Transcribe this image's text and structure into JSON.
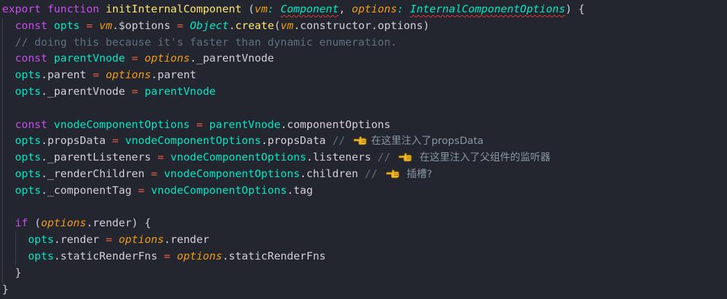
{
  "editor": {
    "language": "javascript",
    "colors": {
      "background": "#23262e",
      "keyword": "#c74ded",
      "function": "#ffe66d",
      "parameter": "#f39c12",
      "type": "#00e8c6",
      "operator": "#ee5d43",
      "comment": "#5f6f7e",
      "text": "#d5ced9"
    },
    "lines": [
      [
        {
          "t": "export",
          "c": "kw"
        },
        {
          "t": " ",
          "c": "punc"
        },
        {
          "t": "function",
          "c": "kw"
        },
        {
          "t": " ",
          "c": "punc"
        },
        {
          "t": "initInternalComponent",
          "c": "fn"
        },
        {
          "t": " (",
          "c": "punc"
        },
        {
          "t": "vm",
          "c": "param"
        },
        {
          "t": ": ",
          "c": "type"
        },
        {
          "t": "Component",
          "c": "type wavy"
        },
        {
          "t": ", ",
          "c": "punc"
        },
        {
          "t": "options",
          "c": "param"
        },
        {
          "t": ": ",
          "c": "type"
        },
        {
          "t": "InternalComponentOptions",
          "c": "type wavy"
        },
        {
          "t": ") {",
          "c": "punc"
        }
      ],
      [
        {
          "t": "  ",
          "c": "punc"
        },
        {
          "t": "const",
          "c": "kw"
        },
        {
          "t": " opts ",
          "c": "prop"
        },
        {
          "t": "=",
          "c": "op"
        },
        {
          "t": " ",
          "c": "punc"
        },
        {
          "t": "vm",
          "c": "param"
        },
        {
          "t": ".$options ",
          "c": "var"
        },
        {
          "t": "=",
          "c": "op"
        },
        {
          "t": " ",
          "c": "punc"
        },
        {
          "t": "Object",
          "c": "type"
        },
        {
          "t": ".",
          "c": "punc"
        },
        {
          "t": "create",
          "c": "fn"
        },
        {
          "t": "(",
          "c": "punc"
        },
        {
          "t": "vm",
          "c": "param"
        },
        {
          "t": ".constructor.options)",
          "c": "var"
        }
      ],
      [
        {
          "t": "  // doing this because it's faster than dynamic enumeration.",
          "c": "cm"
        }
      ],
      [
        {
          "t": "  ",
          "c": "punc"
        },
        {
          "t": "const",
          "c": "kw"
        },
        {
          "t": " parentVnode ",
          "c": "prop"
        },
        {
          "t": "=",
          "c": "op"
        },
        {
          "t": " ",
          "c": "punc"
        },
        {
          "t": "options",
          "c": "param"
        },
        {
          "t": "._parentVnode",
          "c": "var"
        }
      ],
      [
        {
          "t": "  ",
          "c": "punc"
        },
        {
          "t": "opts",
          "c": "prop"
        },
        {
          "t": ".parent ",
          "c": "var"
        },
        {
          "t": "=",
          "c": "op"
        },
        {
          "t": " ",
          "c": "punc"
        },
        {
          "t": "options",
          "c": "param"
        },
        {
          "t": ".parent",
          "c": "var"
        }
      ],
      [
        {
          "t": "  ",
          "c": "punc"
        },
        {
          "t": "opts",
          "c": "prop"
        },
        {
          "t": "._parentVnode ",
          "c": "var"
        },
        {
          "t": "=",
          "c": "op"
        },
        {
          "t": " parentVnode",
          "c": "prop"
        }
      ],
      [
        {
          "t": "",
          "c": "punc"
        }
      ],
      [
        {
          "t": "  ",
          "c": "punc"
        },
        {
          "t": "const",
          "c": "kw"
        },
        {
          "t": " vnodeComponentOptions ",
          "c": "prop"
        },
        {
          "t": "=",
          "c": "op"
        },
        {
          "t": " parentVnode",
          "c": "prop"
        },
        {
          "t": ".componentOptions",
          "c": "var"
        }
      ],
      [
        {
          "t": "  ",
          "c": "punc"
        },
        {
          "t": "opts",
          "c": "prop"
        },
        {
          "t": ".propsData ",
          "c": "var"
        },
        {
          "t": "=",
          "c": "op"
        },
        {
          "t": " vnodeComponentOptions",
          "c": "prop"
        },
        {
          "t": ".propsData ",
          "c": "var"
        },
        {
          "t": "// ",
          "c": "cm"
        },
        {
          "t": "",
          "c": "hand"
        },
        {
          "t": "在这里注入了propsData",
          "c": "cmt"
        }
      ],
      [
        {
          "t": "  ",
          "c": "punc"
        },
        {
          "t": "opts",
          "c": "prop"
        },
        {
          "t": "._parentListeners ",
          "c": "var"
        },
        {
          "t": "=",
          "c": "op"
        },
        {
          "t": " vnodeComponentOptions",
          "c": "prop"
        },
        {
          "t": ".listeners ",
          "c": "var"
        },
        {
          "t": "// ",
          "c": "cm"
        },
        {
          "t": "",
          "c": "hand"
        },
        {
          "t": " 在这里注入了父组件的监听器",
          "c": "cmt"
        }
      ],
      [
        {
          "t": "  ",
          "c": "punc"
        },
        {
          "t": "opts",
          "c": "prop"
        },
        {
          "t": "._renderChildren ",
          "c": "var"
        },
        {
          "t": "=",
          "c": "op"
        },
        {
          "t": " vnodeComponentOptions",
          "c": "prop"
        },
        {
          "t": ".children ",
          "c": "var"
        },
        {
          "t": "// ",
          "c": "cm"
        },
        {
          "t": "",
          "c": "hand"
        },
        {
          "t": " 插槽?",
          "c": "cmt"
        }
      ],
      [
        {
          "t": "  ",
          "c": "punc"
        },
        {
          "t": "opts",
          "c": "prop"
        },
        {
          "t": "._componentTag ",
          "c": "var"
        },
        {
          "t": "=",
          "c": "op"
        },
        {
          "t": " vnodeComponentOptions",
          "c": "prop"
        },
        {
          "t": ".tag",
          "c": "var"
        }
      ],
      [
        {
          "t": "",
          "c": "punc"
        }
      ],
      [
        {
          "t": "  ",
          "c": "punc"
        },
        {
          "t": "if",
          "c": "kw"
        },
        {
          "t": " (",
          "c": "punc"
        },
        {
          "t": "options",
          "c": "param"
        },
        {
          "t": ".render) {",
          "c": "var"
        }
      ],
      [
        {
          "t": "    ",
          "c": "punc"
        },
        {
          "t": "opts",
          "c": "prop"
        },
        {
          "t": ".render ",
          "c": "var"
        },
        {
          "t": "=",
          "c": "op"
        },
        {
          "t": " ",
          "c": "punc"
        },
        {
          "t": "options",
          "c": "param"
        },
        {
          "t": ".render",
          "c": "var"
        }
      ],
      [
        {
          "t": "    ",
          "c": "punc"
        },
        {
          "t": "opts",
          "c": "prop"
        },
        {
          "t": ".staticRenderFns ",
          "c": "var"
        },
        {
          "t": "=",
          "c": "op"
        },
        {
          "t": " ",
          "c": "punc"
        },
        {
          "t": "options",
          "c": "param"
        },
        {
          "t": ".staticRenderFns",
          "c": "var"
        }
      ],
      [
        {
          "t": "  }",
          "c": "punc"
        }
      ],
      [
        {
          "t": "}",
          "c": "punc"
        }
      ]
    ]
  }
}
